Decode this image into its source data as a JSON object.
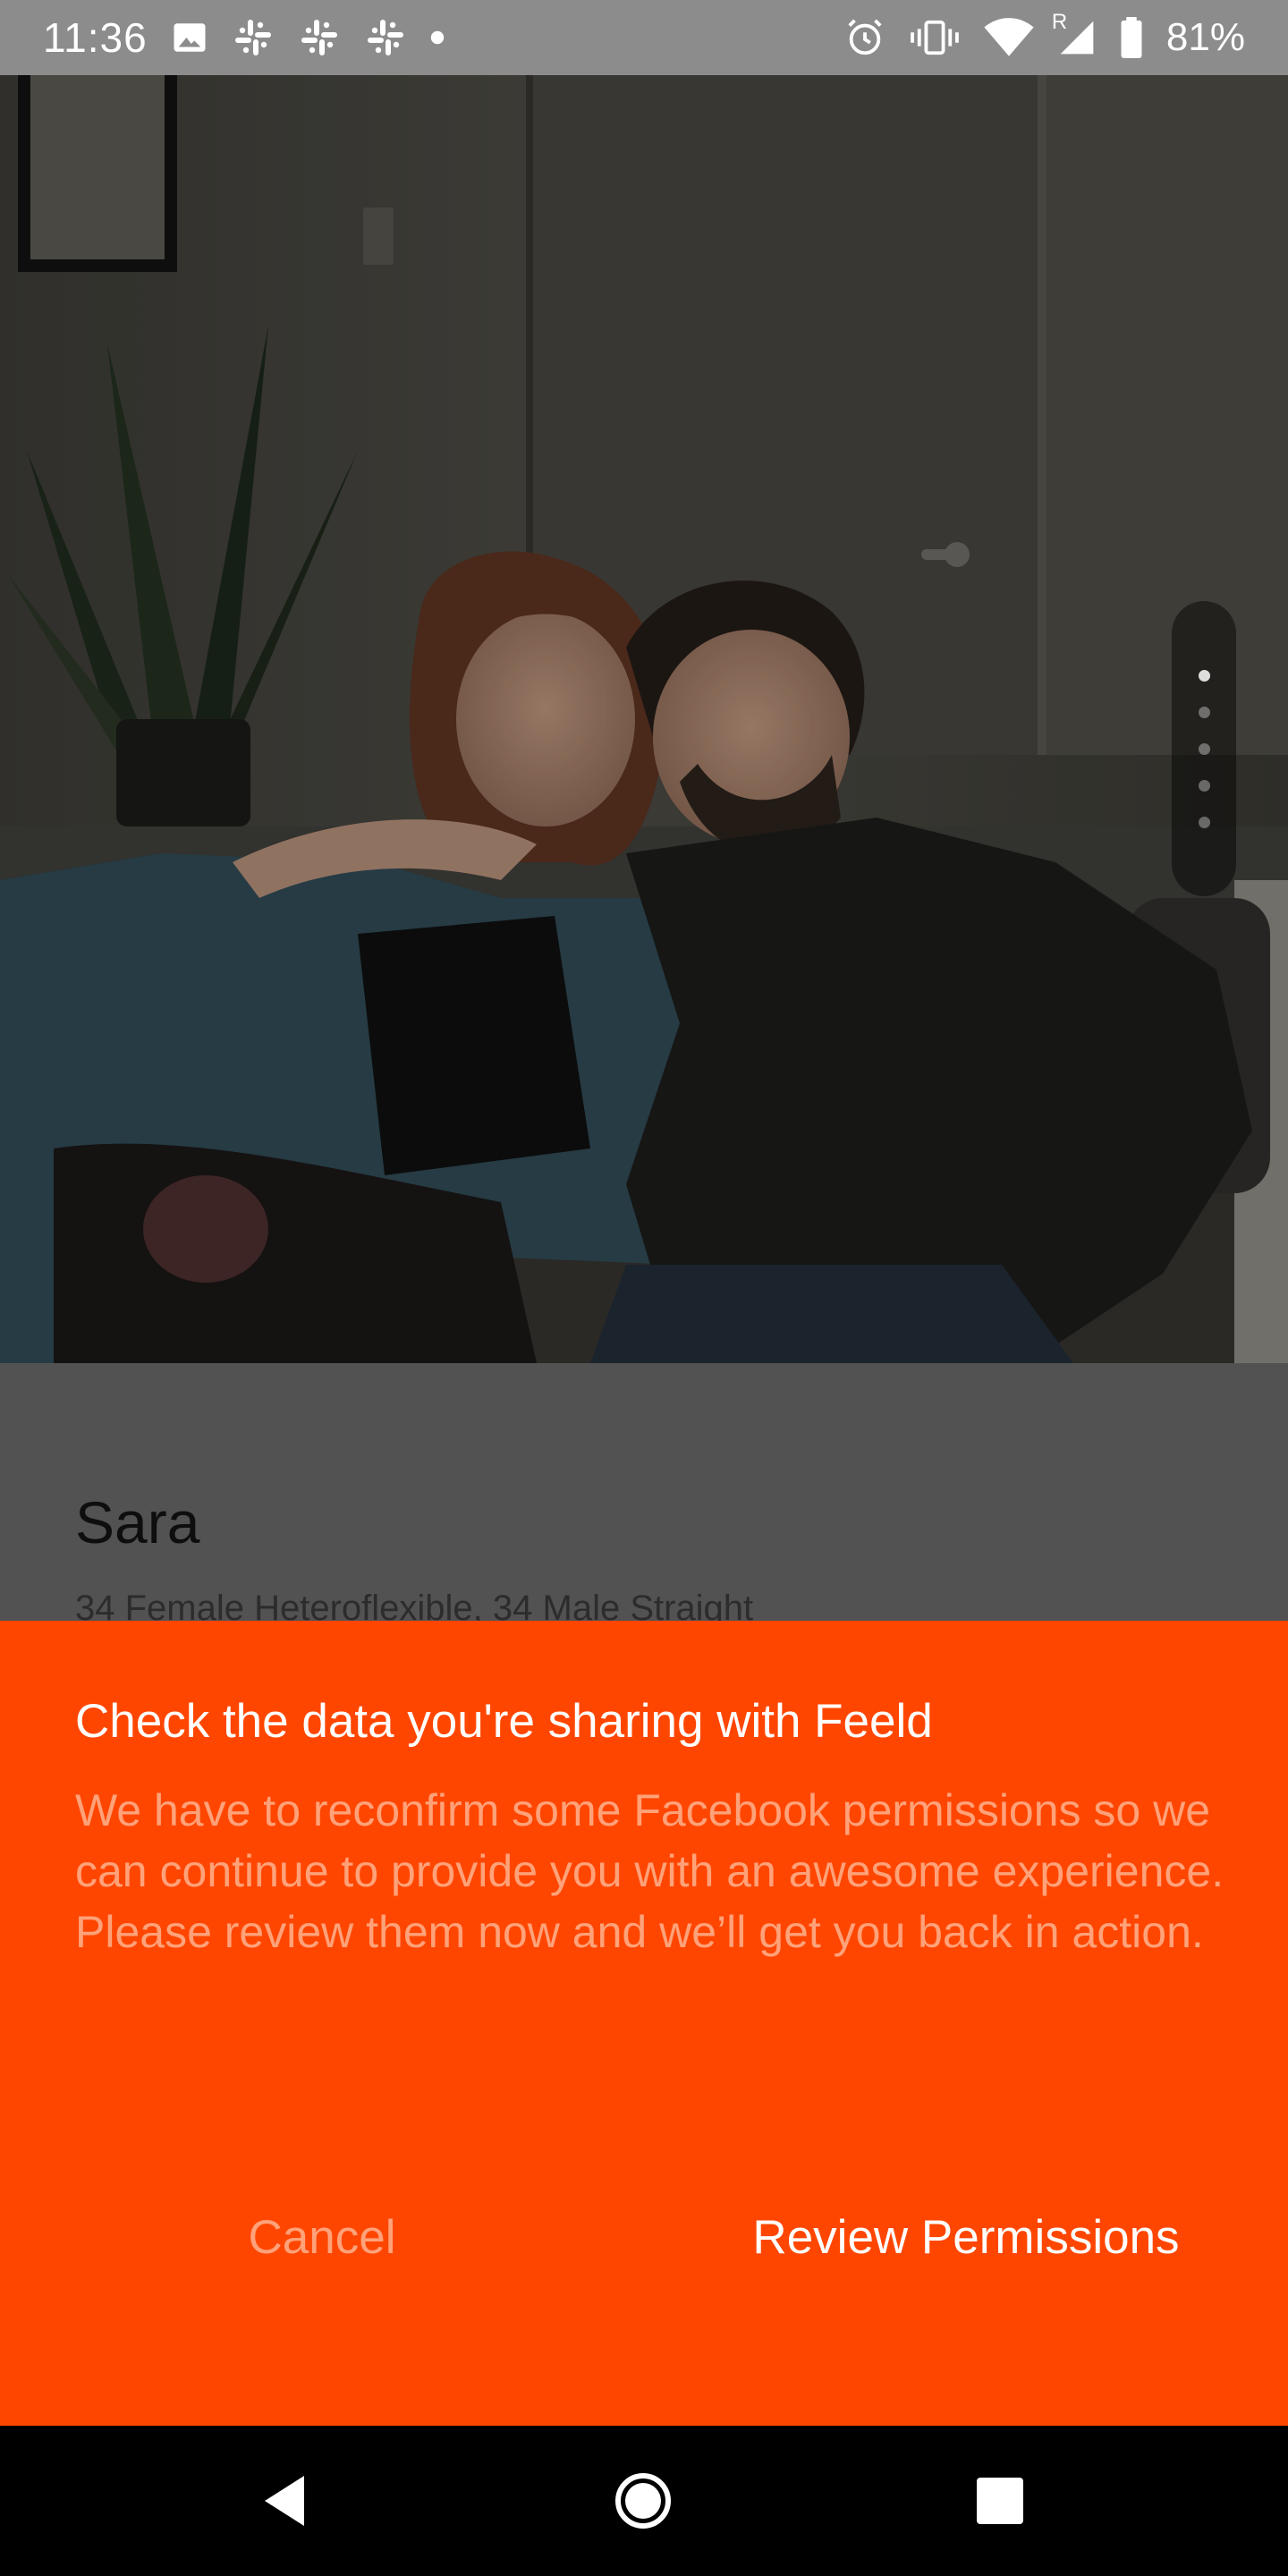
{
  "status_bar": {
    "time": "11:36",
    "battery_percent": "81%",
    "roaming_label": "R",
    "icons_left": [
      "image-icon",
      "slack-icon",
      "slack-icon",
      "slack-icon",
      "dot-icon"
    ],
    "icons_right": [
      "alarm-icon",
      "vibrate-icon",
      "wifi-icon",
      "signal-icon",
      "battery-icon"
    ]
  },
  "photo": {
    "pager": {
      "total": 5,
      "active_index": 0
    }
  },
  "profile": {
    "name": "Sara",
    "meta": "34 Female Heteroflexible, 34 Male Straight"
  },
  "dialog": {
    "title": "Check the data you're sharing with Feeld",
    "body": "We have to reconfirm some Facebook permissions so we can continue to provide you with an awesome experience. Please review them now and we’ll get you back in action.",
    "cancel_label": "Cancel",
    "confirm_label": "Review Permissions",
    "background_color": "#ff4600"
  },
  "nav_bar": {
    "buttons": [
      "back-icon",
      "home-icon",
      "recents-icon"
    ]
  }
}
